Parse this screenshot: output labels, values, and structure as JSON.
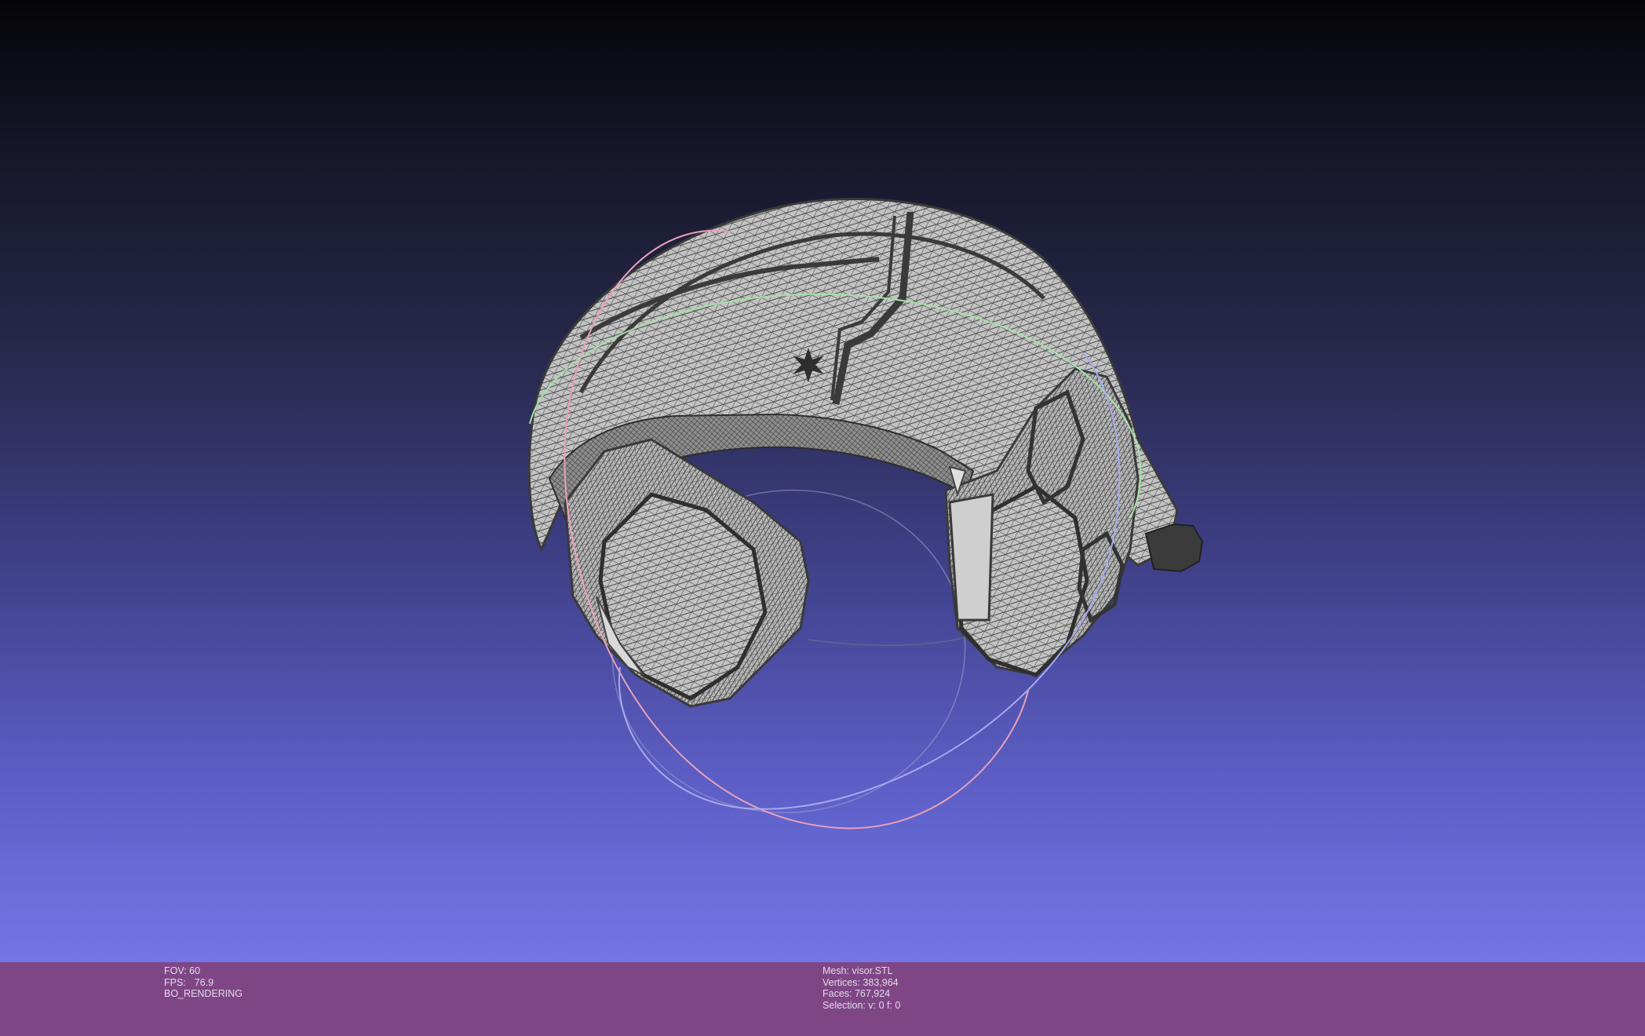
{
  "viewer": {
    "fov_label": "FOV: 60",
    "fps_label": "FPS:",
    "fps_value": "76.9",
    "render_mode": "BO_RENDERING"
  },
  "mesh_info": {
    "mesh_name": "Mesh: visor.STL",
    "vertices": "Vertices: 383,964",
    "faces": "Faces: 767,924",
    "selection": "Selection: v: 0 f: 0"
  },
  "colors": {
    "background_top": "#050508",
    "background_bottom": "#7476e8",
    "info_bar": "#7f4686",
    "mesh_fill": "#bdbdbd",
    "mesh_wire": "#3c3c3c",
    "trackball_x": "#e8a0b8",
    "trackball_y": "#a4e0a8",
    "trackball_z": "#a8a8ee"
  }
}
